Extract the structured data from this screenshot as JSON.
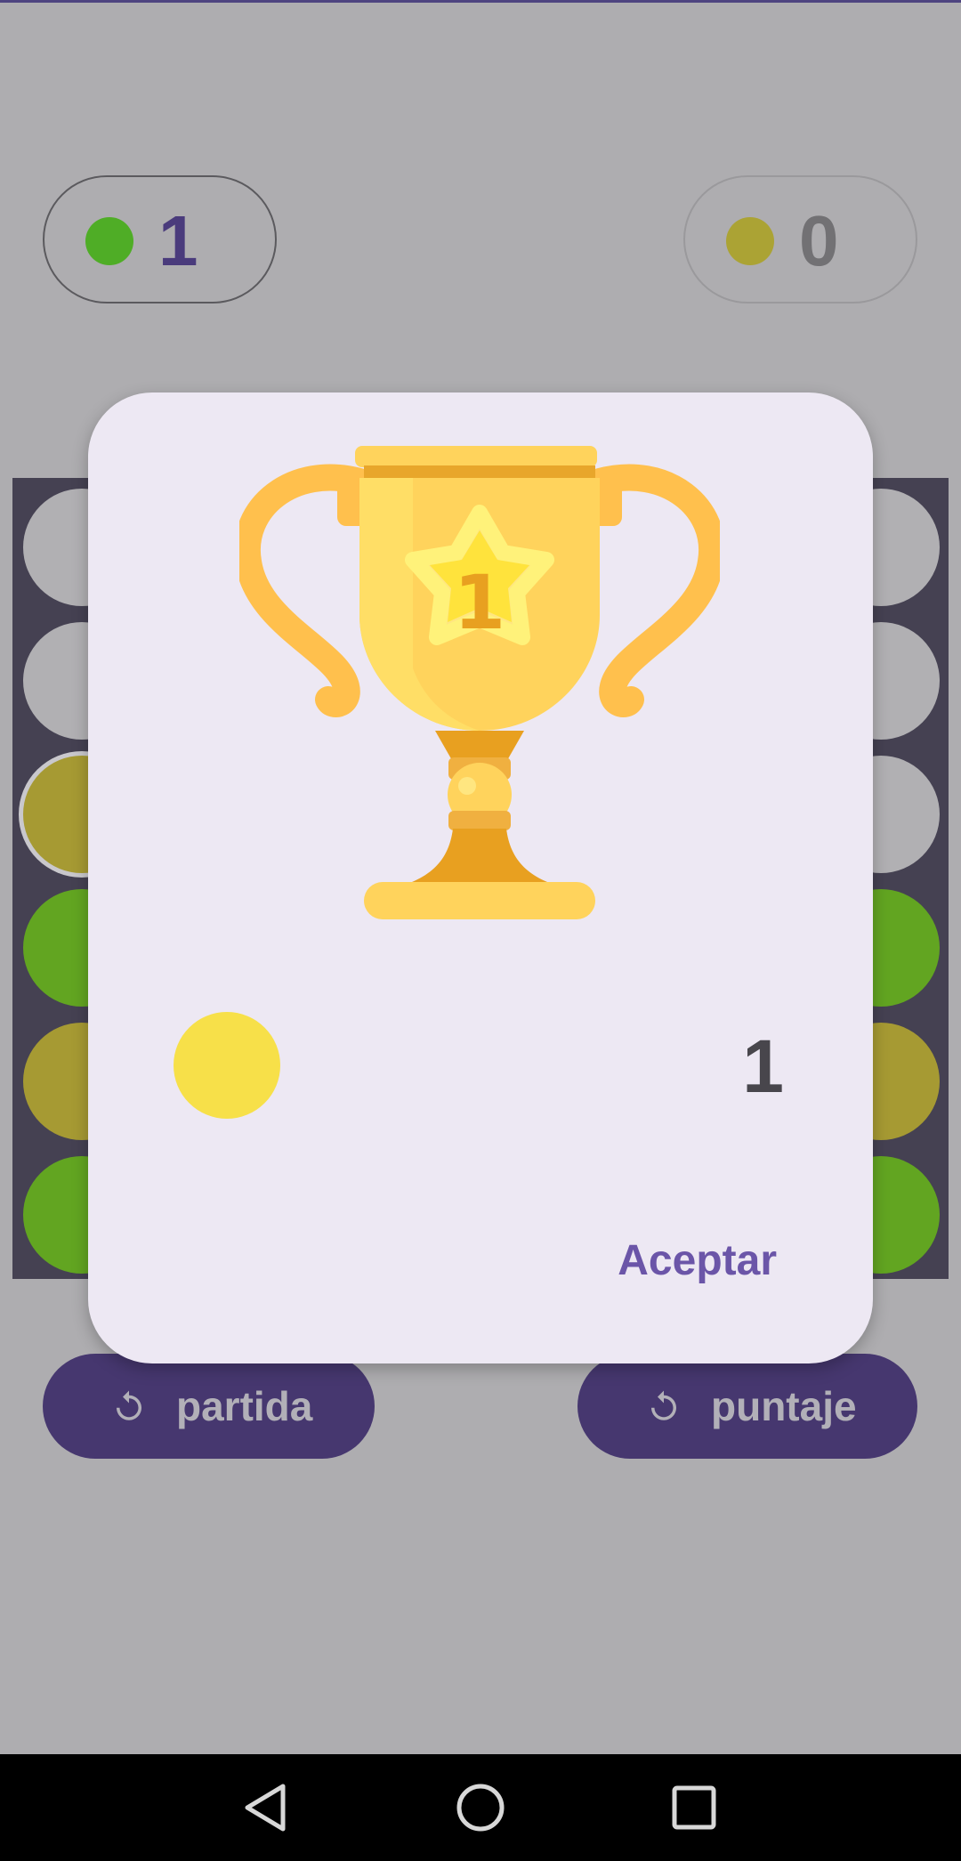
{
  "colors": {
    "background": "#aeadb0",
    "accent": "#4a3b7c",
    "player1_token": "#4fad26",
    "player2_token": "#aba334",
    "winner_token": "#f7e049",
    "green_piece": "#62a521",
    "yellow_piece": "#a69a33",
    "empty_cell": "#b1b0b3"
  },
  "scoreboard": {
    "player1": {
      "score": "1",
      "icon": "green-token-icon"
    },
    "player2": {
      "score": "0",
      "icon": "yellow-token-icon"
    }
  },
  "board": {
    "visible_left_column": [
      "empty",
      "empty",
      "yellow",
      "green",
      "yellow",
      "green"
    ],
    "visible_right_column": [
      "empty",
      "empty",
      "empty",
      "green",
      "yellow",
      "green"
    ]
  },
  "buttons": {
    "reset_game": {
      "label": "partida",
      "icon": "refresh-icon"
    },
    "reset_score": {
      "label": "puntaje",
      "icon": "refresh-icon"
    }
  },
  "dialog": {
    "image": "trophy-icon",
    "trophy_number": "1",
    "winner_token_color": "#f7e049",
    "winner_score": "1",
    "accept_label": "Aceptar"
  },
  "navbar": {
    "items": [
      "back-icon",
      "home-icon",
      "recents-icon"
    ]
  }
}
